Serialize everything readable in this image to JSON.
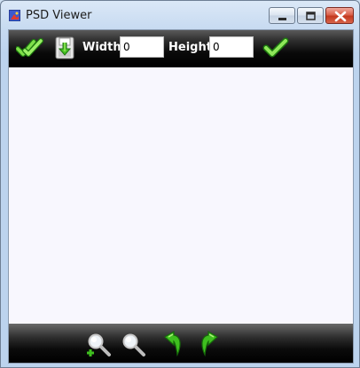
{
  "window": {
    "title": "PSD Viewer"
  },
  "toolbar": {
    "width_label": "Width",
    "width_value": "0",
    "height_label": "Height",
    "height_value": "0"
  },
  "icons": {
    "open": "double-check-icon",
    "save": "save-disk-icon",
    "apply": "check-icon",
    "zoom_in": "zoom-in-icon",
    "zoom_out": "zoom-out-icon",
    "rotate_left": "rotate-left-icon",
    "rotate_right": "rotate-right-icon"
  },
  "colors": {
    "toolbar_bg": "#000000",
    "canvas_bg": "#f8f7fe",
    "accent_green": "#3fbf1f",
    "close_red": "#c3391f"
  }
}
